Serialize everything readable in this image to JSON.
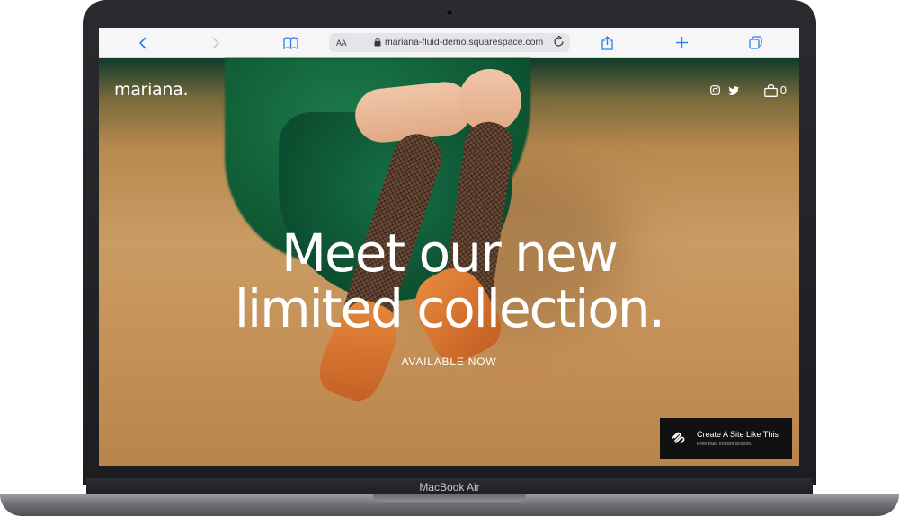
{
  "device": {
    "label": "MacBook Air"
  },
  "browser": {
    "text_size_label": "AA",
    "url": "mariana-fluid-demo.squarespace.com",
    "icons": [
      "back-icon",
      "forward-icon",
      "bookmarks-icon",
      "lock-icon",
      "reload-icon",
      "share-icon",
      "new-tab-icon",
      "tabs-icon"
    ]
  },
  "site": {
    "logo": "mariana.",
    "cart_count": "0",
    "headline_line1": "Meet our new",
    "headline_line2": "limited collection.",
    "cta_text": "AVAILABLE NOW",
    "social_icons": [
      "instagram-icon",
      "twitter-icon"
    ]
  },
  "promo": {
    "title": "Create A Site Like This",
    "subtitle": "Free trial. Instant access."
  },
  "colors": {
    "accent": "#2f7cf6",
    "hero_bg": "#c99c64",
    "dress": "#0f5a34",
    "shoe": "#e07a33"
  }
}
